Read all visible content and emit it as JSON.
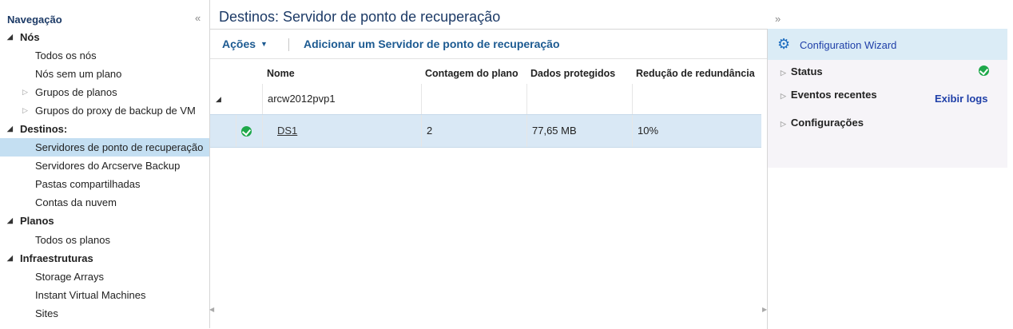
{
  "nav": {
    "title": "Navegação",
    "groups": [
      {
        "label": "Nós",
        "items": [
          {
            "label": "Todos os nós"
          },
          {
            "label": "Nós sem um plano"
          },
          {
            "label": "Grupos de planos"
          },
          {
            "label": "Grupos do proxy de backup de VM"
          }
        ]
      },
      {
        "label": "Destinos:",
        "items": [
          {
            "label": "Servidores de ponto de recuperação"
          },
          {
            "label": "Servidores do Arcserve Backup"
          },
          {
            "label": "Pastas compartilhadas"
          },
          {
            "label": "Contas da nuvem"
          }
        ]
      },
      {
        "label": "Planos",
        "items": [
          {
            "label": "Todos os planos"
          }
        ]
      },
      {
        "label": "Infraestruturas",
        "items": [
          {
            "label": "Storage Arrays"
          },
          {
            "label": "Instant Virtual Machines"
          },
          {
            "label": "Sites"
          }
        ]
      }
    ]
  },
  "main": {
    "title": "Destinos: Servidor de ponto de recuperação",
    "toolbar": {
      "actions_label": "Ações",
      "add_label": "Adicionar um Servidor de ponto de recuperação"
    },
    "columns": [
      "Nome",
      "Contagem do plano",
      "Dados protegidos",
      "Redução de redundância"
    ],
    "group_row": {
      "name": "arcw2012pvp1"
    },
    "rows": [
      {
        "name": "DS1",
        "plan_count": "2",
        "protected_data": "77,65 MB",
        "dedup": "10%"
      }
    ]
  },
  "right": {
    "wizard_label": "Configuration Wizard",
    "status_label": "Status",
    "events_label": "Eventos recentes",
    "view_logs_label": "Exibir logs",
    "settings_label": "Configurações"
  },
  "colors": {
    "accent": "#1c5a91",
    "selected_bg": "#c4dff2",
    "status_ok": "#1ea84a"
  }
}
